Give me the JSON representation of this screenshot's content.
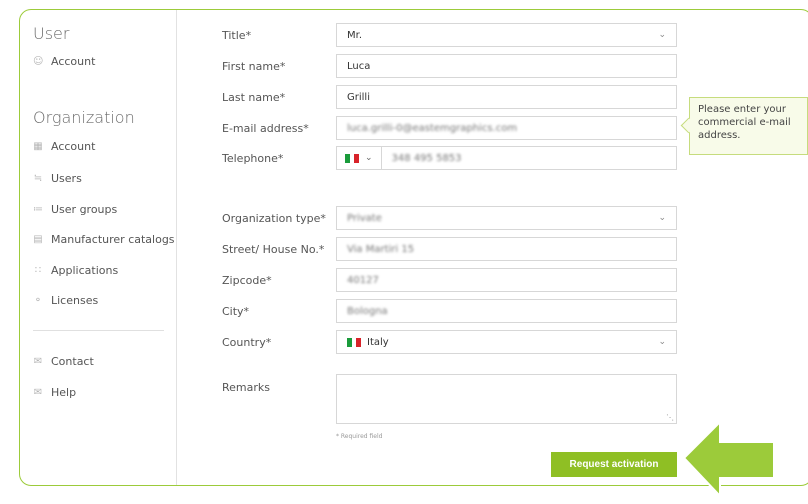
{
  "sidebar": {
    "user_heading": "User",
    "user_items": [
      {
        "label": "Account",
        "icon": "person-icon"
      }
    ],
    "org_heading": "Organization",
    "org_items": [
      {
        "label": "Account",
        "icon": "building-icon"
      },
      {
        "label": "Users",
        "icon": "users-icon"
      },
      {
        "label": "User groups",
        "icon": "user-groups-icon"
      },
      {
        "label": "Manufacturer catalogs",
        "icon": "catalog-icon"
      },
      {
        "label": "Applications",
        "icon": "grid-icon"
      },
      {
        "label": "Licenses",
        "icon": "key-icon"
      }
    ],
    "bottom_items": [
      {
        "label": "Contact",
        "icon": "mail-icon"
      },
      {
        "label": "Help",
        "icon": "help-icon"
      }
    ]
  },
  "form": {
    "title": {
      "label": "Title*",
      "value": "Mr."
    },
    "first_name": {
      "label": "First name*",
      "value": "Luca"
    },
    "last_name": {
      "label": "Last name*",
      "value": "Grilli"
    },
    "email": {
      "label": "E-mail address*",
      "value": "luca.grilli-0@eastemgraphics.com"
    },
    "telephone": {
      "label": "Telephone*",
      "value": "348 495 5853"
    },
    "org_type": {
      "label": "Organization type*",
      "value": "Private"
    },
    "street": {
      "label": "Street/ House No.*",
      "value": "Via Martiri 15"
    },
    "zipcode": {
      "label": "Zipcode*",
      "value": "40127"
    },
    "city": {
      "label": "City*",
      "value": "Bologna"
    },
    "country": {
      "label": "Country*",
      "value": "Italy"
    },
    "remarks": {
      "label": "Remarks",
      "value": ""
    },
    "required_note": "* Required field",
    "submit_label": "Request activation"
  },
  "tooltip": {
    "text": "Please enter your commercial e-mail address."
  },
  "colors": {
    "accent": "#8fbf24",
    "border": "#9ccb3a",
    "tooltip_bg": "#f8fbe9"
  }
}
